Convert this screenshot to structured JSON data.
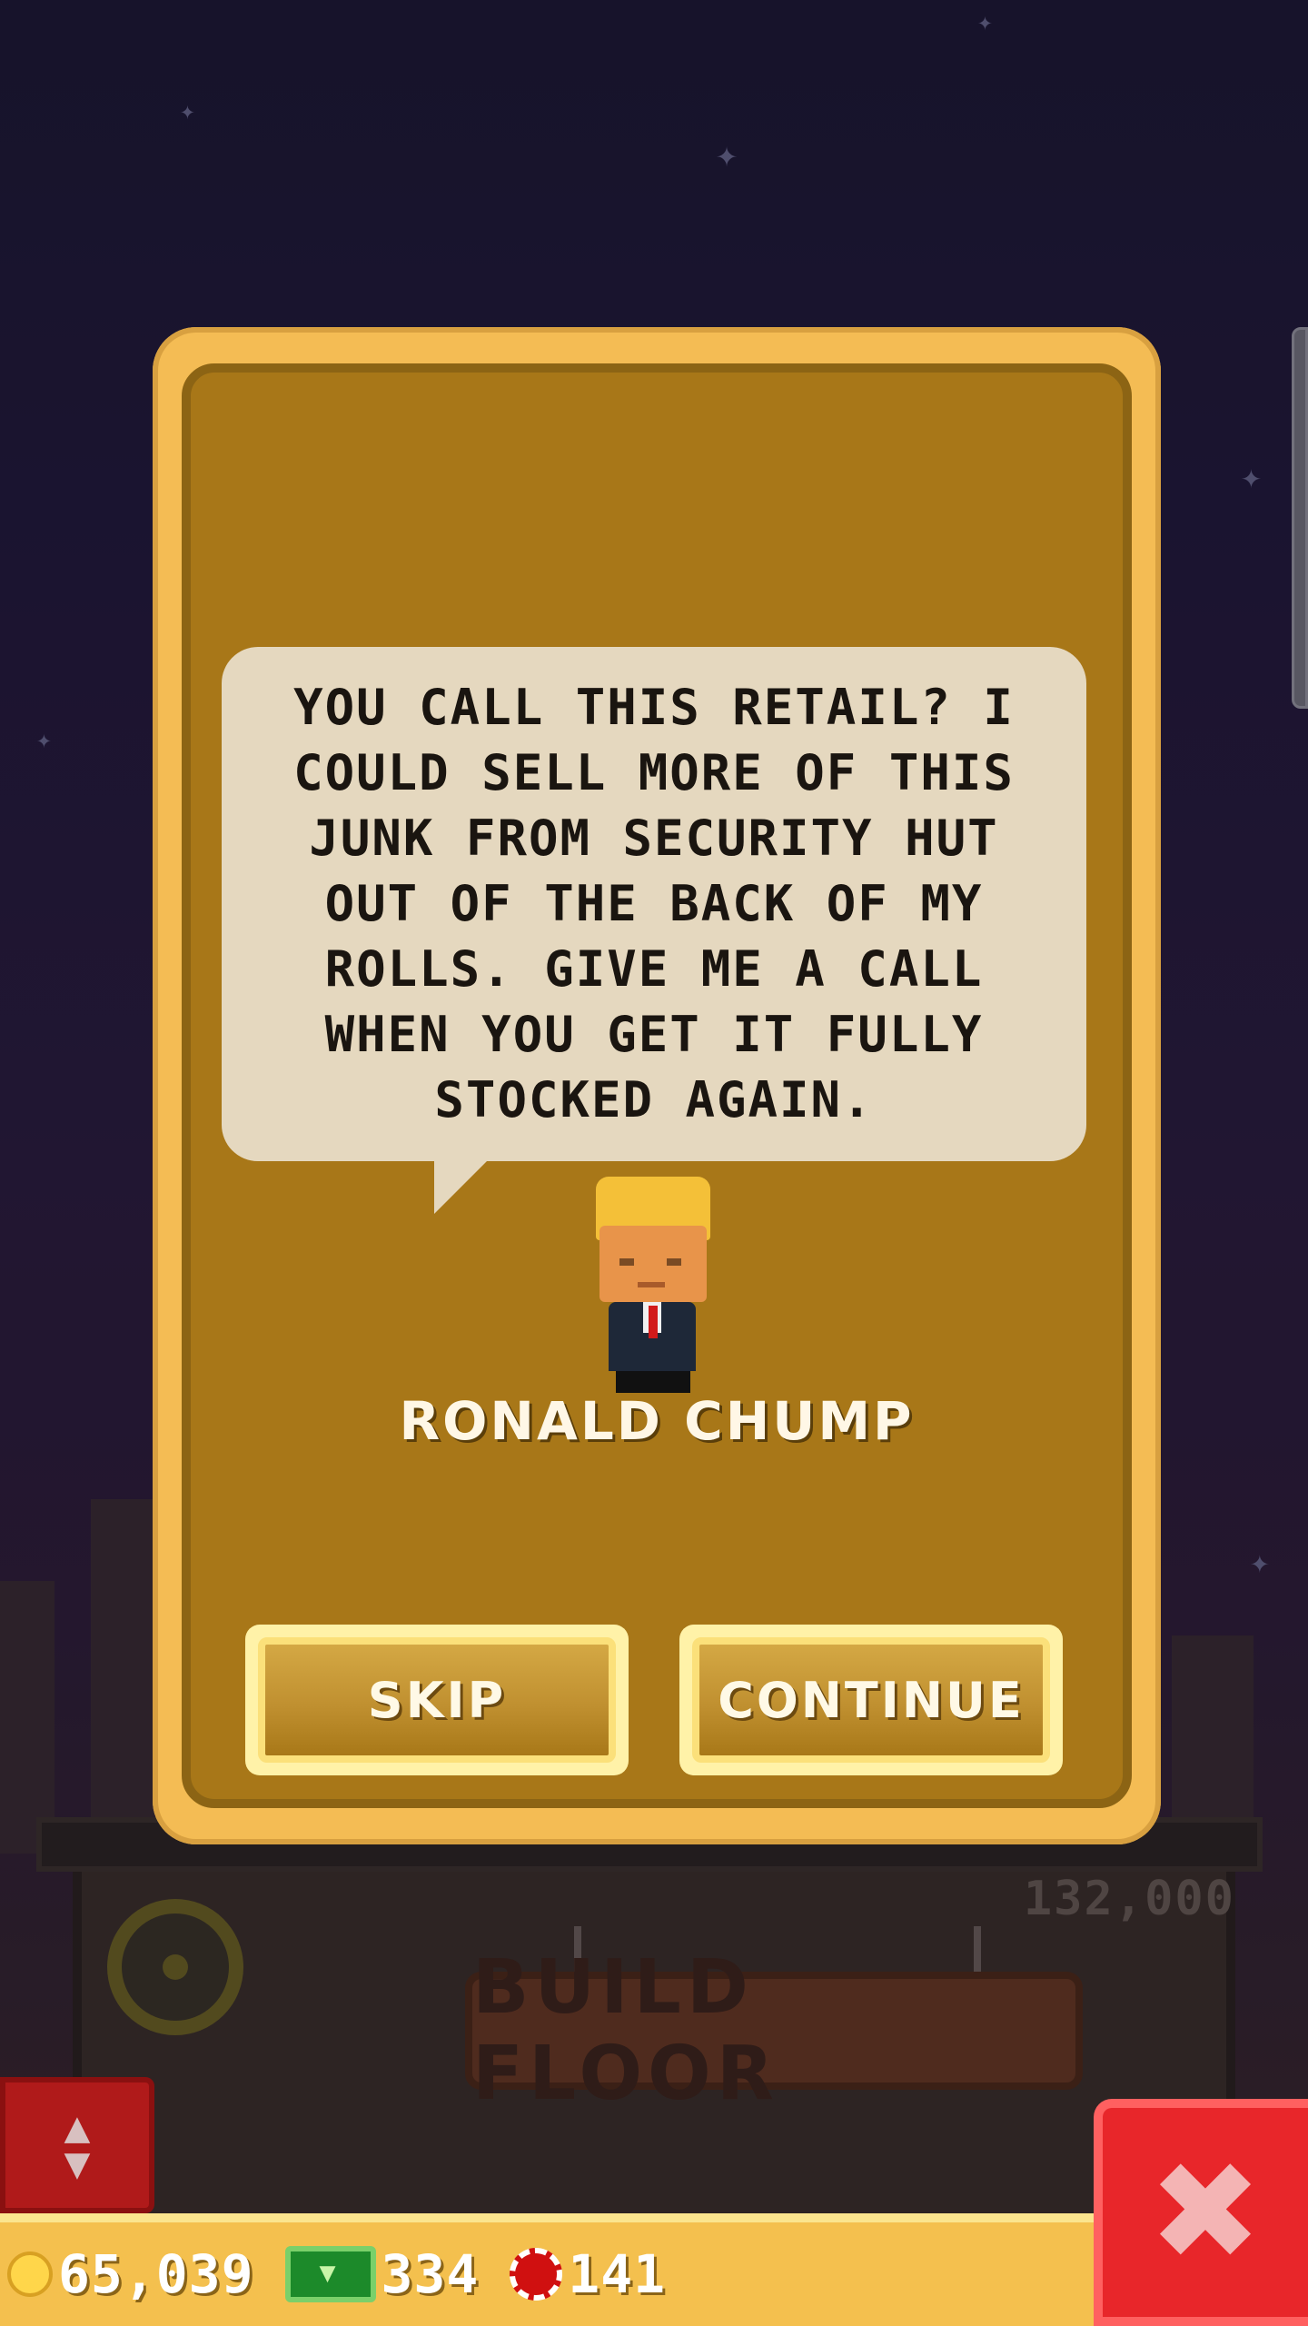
{
  "scene": {
    "floor_cost": "132,000",
    "build_floor_label": "BUILD FLOOR"
  },
  "dialog": {
    "message": "YOU CALL THIS RETAIL? I COULD SELL MORE OF THIS JUNK FROM SECURITY HUT OUT OF THE BACK OF MY ROLLS. GIVE ME A CALL WHEN YOU GET IT FULLY STOCKED AGAIN.",
    "character_name": "RONALD CHUMP",
    "skip_label": "SKIP",
    "continue_label": "CONTINUE"
  },
  "hud": {
    "coins": "65,039",
    "tower_bux": "334",
    "chips": "141"
  },
  "icons": {
    "coin": "coin-icon",
    "cash": "tower-bux-icon",
    "chip": "chip-icon",
    "close": "close-icon",
    "elevator": "elevator-arrows-icon"
  },
  "colors": {
    "dialog_frame": "#f4bc54",
    "dialog_panel": "#a87718",
    "bubble": "#e5d8bf",
    "close_button": "#e8262a",
    "hud_bar": "#f4c04e"
  }
}
